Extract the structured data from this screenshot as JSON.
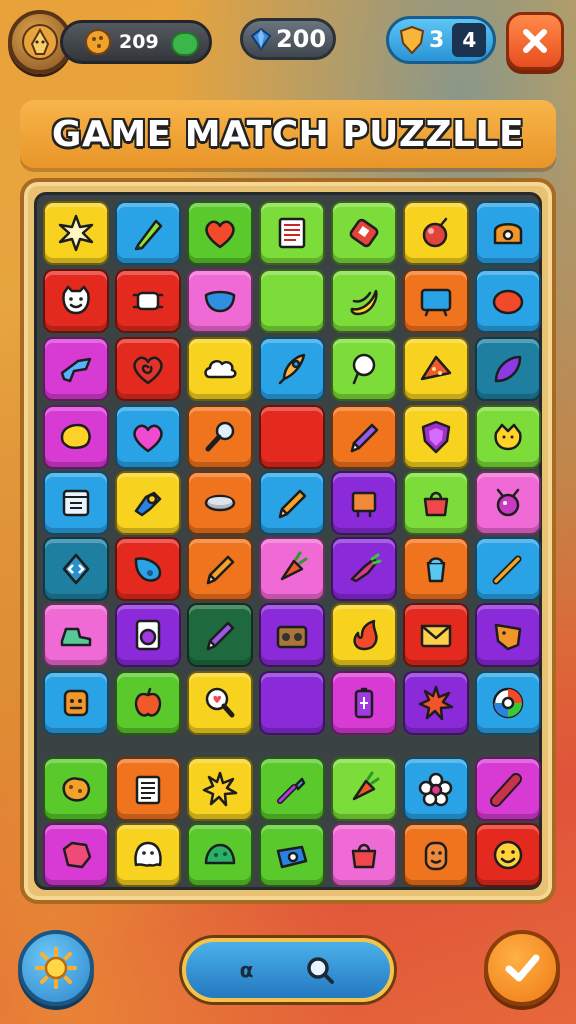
{
  "hud": {
    "coins": "209",
    "gems": "200",
    "keys": "3",
    "key_level": "4"
  },
  "title": "GAME MATCH PUZZLLE",
  "colors": {
    "yellow": "#f7d21e",
    "blue": "#2aa3e6",
    "green": "#5ac92c",
    "lime": "#7cdc3a",
    "red": "#e42a1e",
    "orange": "#f0731e",
    "pink": "#f06ad6",
    "magenta": "#d83ad4",
    "purple": "#8a2ad8",
    "teal": "#1f7fa0",
    "dkgreen": "#1e6a3e"
  },
  "board": {
    "rows": [
      [
        {
          "c": "yellow",
          "i": "star-burst"
        },
        {
          "c": "blue",
          "i": "marker"
        },
        {
          "c": "green",
          "i": "heart"
        },
        {
          "c": "lime",
          "i": "document"
        },
        {
          "c": "lime",
          "i": "phone"
        },
        {
          "c": "yellow",
          "i": "bomb"
        },
        {
          "c": "blue",
          "i": "chest"
        }
      ],
      [
        {
          "c": "red",
          "i": "cat-face"
        },
        {
          "c": "red",
          "i": "crab"
        },
        {
          "c": "pink",
          "i": "mask"
        },
        {
          "c": "lime",
          "i": "empty"
        },
        {
          "c": "lime",
          "i": "banana"
        },
        {
          "c": "orange",
          "i": "tv"
        },
        {
          "c": "blue",
          "i": "blob"
        }
      ],
      [
        {
          "c": "magenta",
          "i": "blaster"
        },
        {
          "c": "red",
          "i": "spiral-heart"
        },
        {
          "c": "yellow",
          "i": "cloud"
        },
        {
          "c": "blue",
          "i": "rocket"
        },
        {
          "c": "lime",
          "i": "pin"
        },
        {
          "c": "yellow",
          "i": "pizza"
        },
        {
          "c": "teal",
          "i": "leaf"
        }
      ],
      [
        {
          "c": "magenta",
          "i": "lemon"
        },
        {
          "c": "blue",
          "i": "heart-pink"
        },
        {
          "c": "orange",
          "i": "microphone"
        },
        {
          "c": "red",
          "i": "empty"
        },
        {
          "c": "orange",
          "i": "pen"
        },
        {
          "c": "yellow",
          "i": "shield"
        },
        {
          "c": "lime",
          "i": "critter"
        }
      ],
      [
        {
          "c": "blue",
          "i": "calendar"
        },
        {
          "c": "yellow",
          "i": "robot"
        },
        {
          "c": "orange",
          "i": "disc"
        },
        {
          "c": "blue",
          "i": "pencil"
        },
        {
          "c": "purple",
          "i": "crate"
        },
        {
          "c": "lime",
          "i": "bag"
        },
        {
          "c": "pink",
          "i": "bug"
        }
      ],
      [
        {
          "c": "teal",
          "i": "diamond"
        },
        {
          "c": "red",
          "i": "drop"
        },
        {
          "c": "orange",
          "i": "pencil"
        },
        {
          "c": "pink",
          "i": "carrot"
        },
        {
          "c": "purple",
          "i": "fish"
        },
        {
          "c": "orange",
          "i": "cup"
        },
        {
          "c": "blue",
          "i": "stick"
        }
      ],
      [
        {
          "c": "pink",
          "i": "boot"
        },
        {
          "c": "purple",
          "i": "washer"
        },
        {
          "c": "dkgreen",
          "i": "pen"
        },
        {
          "c": "purple",
          "i": "radio"
        },
        {
          "c": "yellow",
          "i": "flame"
        },
        {
          "c": "red",
          "i": "envelope"
        },
        {
          "c": "purple",
          "i": "fox"
        }
      ],
      [
        {
          "c": "blue",
          "i": "tiger"
        },
        {
          "c": "green",
          "i": "apple"
        },
        {
          "c": "yellow",
          "i": "magnifier-heart"
        },
        {
          "c": "purple",
          "i": "empty"
        },
        {
          "c": "magenta",
          "i": "battery"
        },
        {
          "c": "purple",
          "i": "splat"
        },
        {
          "c": "blue",
          "i": "wheel"
        }
      ],
      [
        {
          "c": "green",
          "i": "cookie"
        },
        {
          "c": "orange",
          "i": "clipboard"
        },
        {
          "c": "yellow",
          "i": "spark"
        },
        {
          "c": "green",
          "i": "wand"
        },
        {
          "c": "lime",
          "i": "carrot"
        },
        {
          "c": "blue",
          "i": "flower"
        },
        {
          "c": "magenta",
          "i": "rolling-pin"
        }
      ],
      [
        {
          "c": "magenta",
          "i": "gem-face"
        },
        {
          "c": "yellow",
          "i": "ghost"
        },
        {
          "c": "green",
          "i": "slime"
        },
        {
          "c": "green",
          "i": "camera"
        },
        {
          "c": "pink",
          "i": "bag"
        },
        {
          "c": "orange",
          "i": "face"
        },
        {
          "c": "red",
          "i": "smile"
        }
      ]
    ]
  },
  "bottom": {
    "search_label": "α"
  }
}
